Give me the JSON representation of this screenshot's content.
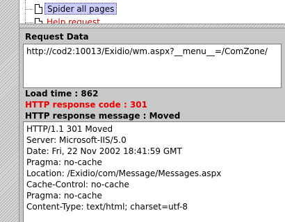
{
  "tree": {
    "selected_item": "Spider all pages",
    "next_item": "Help request"
  },
  "request": {
    "label": "Request Data",
    "url": "http://cod2:10013/Exidio/wm.aspx?__menu__=/ComZone/"
  },
  "response": {
    "load_time": "Load time : 862",
    "code": "HTTP response code : 301",
    "message": "HTTP response message : Moved",
    "headers": [
      "HTTP/1.1 301 Moved",
      "Server: Microsoft-IIS/5.0",
      "Date: Fri, 22 Nov 2002 18:41:59 GMT",
      "Pragma: no-cache",
      "Location: /Exidio/com/Message/Messages.aspx",
      "Cache-Control: no-cache",
      "Pragma: no-cache",
      "Content-Type: text/html; charset=utf-8"
    ]
  },
  "colors": {
    "error_text": "#ee0000",
    "selection_bg": "#ccccff",
    "panel_bg": "#c8c8c8"
  }
}
